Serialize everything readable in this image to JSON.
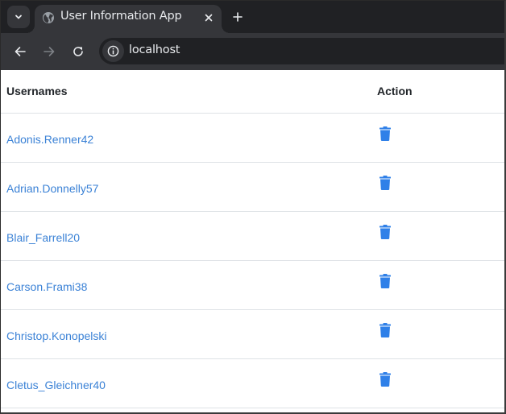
{
  "browser": {
    "tab": {
      "title": "User Information App",
      "favicon": "globe-icon",
      "close_icon": "close-icon"
    },
    "tab_list_icon": "chevron-down-icon",
    "new_tab_icon": "plus-icon",
    "toolbar": {
      "back_icon": "arrow-left-icon",
      "forward_icon": "arrow-right-icon",
      "reload_icon": "reload-icon",
      "site_info_icon": "info-icon",
      "url": "localhost"
    }
  },
  "table": {
    "headers": {
      "usernames": "Usernames",
      "action": "Action"
    },
    "action_icon": "trash-icon",
    "action_color": "#2f80e8",
    "link_color": "#3b82d6",
    "rows": [
      {
        "username": "Adonis.Renner42"
      },
      {
        "username": "Adrian.Donnelly57"
      },
      {
        "username": "Blair_Farrell20"
      },
      {
        "username": "Carson.Frami38"
      },
      {
        "username": "Christop.Konopelski"
      },
      {
        "username": "Cletus_Gleichner40"
      }
    ]
  }
}
